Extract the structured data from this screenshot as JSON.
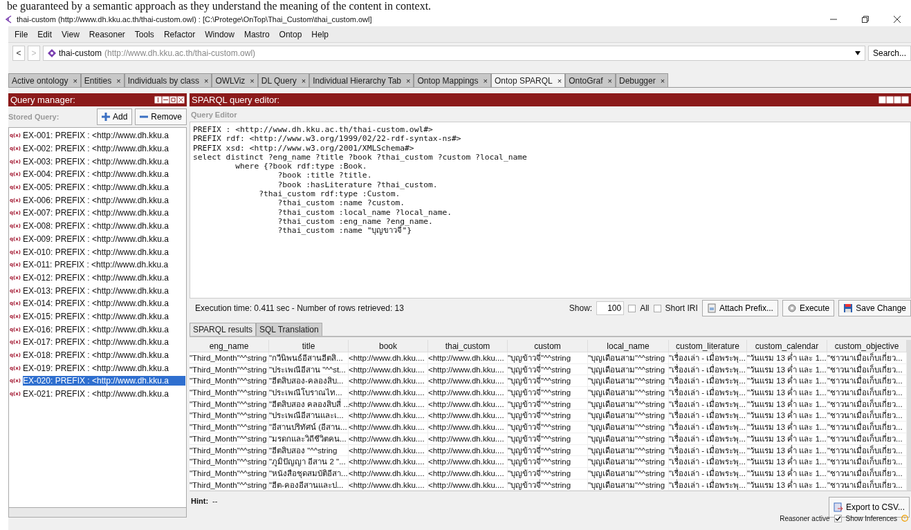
{
  "caption": "be guaranteed by a semantic approach as they understand the meaning of the content in context.",
  "window": {
    "title": "thai-custom (http://www.dh.kku.ac.th/thai-custom.owl)  : [C:\\Protege\\OnTop\\Thai_Custom\\thai_custom.owl]"
  },
  "menu": [
    "File",
    "Edit",
    "View",
    "Reasoner",
    "Tools",
    "Refactor",
    "Window",
    "Mastro",
    "Ontop",
    "Help"
  ],
  "address": {
    "back": "<",
    "forward": ">",
    "name": "thai-custom",
    "iri": "(http://www.dh.kku.ac.th/thai-custom.owl)",
    "search": "Search..."
  },
  "tabs": [
    {
      "label": "Active ontology",
      "selected": false
    },
    {
      "label": "Entities",
      "selected": false
    },
    {
      "label": "Individuals by class",
      "selected": false
    },
    {
      "label": "OWLViz",
      "selected": false
    },
    {
      "label": "DL Query",
      "selected": false
    },
    {
      "label": "Individual Hierarchy Tab",
      "selected": false
    },
    {
      "label": "Ontop Mappings",
      "selected": false
    },
    {
      "label": "Ontop SPARQL",
      "selected": true
    },
    {
      "label": "OntoGraf",
      "selected": false
    },
    {
      "label": "Debugger",
      "selected": false
    }
  ],
  "tab_close": "×",
  "query_manager": {
    "title": "Query manager:",
    "stored_label": "Stored Query:",
    "add": "Add",
    "remove": "Remove",
    "items": [
      {
        "marker": "q(x)",
        "label": "EX-001: PREFIX : <http://www.dh.kku.a",
        "selected": false
      },
      {
        "marker": "q(x)",
        "label": "EX-002: PREFIX : <http://www.dh.kku.a",
        "selected": false
      },
      {
        "marker": "q(x)",
        "label": "EX-003: PREFIX : <http://www.dh.kku.a",
        "selected": false
      },
      {
        "marker": "q(x)",
        "label": "EX-004: PREFIX : <http://www.dh.kku.a",
        "selected": false
      },
      {
        "marker": "q(x)",
        "label": "EX-005: PREFIX : <http://www.dh.kku.a",
        "selected": false
      },
      {
        "marker": "q(x)",
        "label": "EX-006: PREFIX : <http://www.dh.kku.a",
        "selected": false
      },
      {
        "marker": "q(x)",
        "label": "EX-007: PREFIX : <http://www.dh.kku.a",
        "selected": false
      },
      {
        "marker": "q(x)",
        "label": "EX-008: PREFIX : <http://www.dh.kku.a",
        "selected": false
      },
      {
        "marker": "q(x)",
        "label": "EX-009: PREFIX : <http://www.dh.kku.a",
        "selected": false
      },
      {
        "marker": "q(x)",
        "label": "EX-010: PREFIX : <http://www.dh.kku.a",
        "selected": false
      },
      {
        "marker": "q(x)",
        "label": "EX-011: PREFIX : <http://www.dh.kku.a",
        "selected": false
      },
      {
        "marker": "q(x)",
        "label": "EX-012: PREFIX : <http://www.dh.kku.a",
        "selected": false
      },
      {
        "marker": "q(x)",
        "label": "EX-013: PREFIX : <http://www.dh.kku.a",
        "selected": false
      },
      {
        "marker": "q(x)",
        "label": "EX-014: PREFIX : <http://www.dh.kku.a",
        "selected": false
      },
      {
        "marker": "q(x)",
        "label": "EX-015: PREFIX : <http://www.dh.kku.a",
        "selected": false
      },
      {
        "marker": "q(x)",
        "label": "EX-016: PREFIX : <http://www.dh.kku.a",
        "selected": false
      },
      {
        "marker": "q(x)",
        "label": "EX-017: PREFIX : <http://www.dh.kku.a",
        "selected": false
      },
      {
        "marker": "q(x)",
        "label": "EX-018: PREFIX : <http://www.dh.kku.a",
        "selected": false
      },
      {
        "marker": "q(x)",
        "label": "EX-019: PREFIX : <http://www.dh.kku.a",
        "selected": false
      },
      {
        "marker": "q(x)",
        "label": "EX-020: PREFIX : <http://www.dh.kku.a",
        "selected": true
      },
      {
        "marker": "q(x)",
        "label": "EX-021: PREFIX : <http://www.dh.kku.a",
        "selected": false
      }
    ]
  },
  "editor": {
    "title": "SPARQL query editor:",
    "label": "Query Editor",
    "query": "PREFIX : <http://www.dh.kku.ac.th/thai-custom.owl#>\nPREFIX rdf: <http://www.w3.org/1999/02/22-rdf-syntax-ns#>\nPREFIX xsd: <http://www.w3.org/2001/XMLSchema#>\nselect distinct ?eng_name ?title ?book ?thai_custom ?custom ?local_name\n         where {?book rdf:type :Book.\n                  ?book :title ?title.\n                  ?book :hasLiterature ?thai_custom.\n              ?thai_custom rdf:type :Custom.\n                  ?thai_custom :name ?custom.\n                  ?thai_custom :local_name ?local_name.\n                  ?thai_custom :eng_name ?eng_name.\n                  ?thai_custom :name \"บุญขาวจี่\"}",
    "status": "Execution time: 0.411 sec - Number of rows retrieved: 13",
    "show_label": "Show:",
    "show_value": "100",
    "all": {
      "label": "All",
      "checked": false
    },
    "short_iri": {
      "label": "Short IRI",
      "checked": false
    },
    "buttons": [
      "Attach Prefix...",
      "Execute",
      "Save Change"
    ]
  },
  "result_tabs": [
    {
      "label": "SPARQL results",
      "selected": true
    },
    {
      "label": "SQL Translation",
      "selected": false
    }
  ],
  "table": {
    "columns": [
      "eng_name",
      "title",
      "book",
      "thai_custom",
      "custom",
      "local_name",
      "custom_literature",
      "custom_calendar",
      "custom_objective"
    ],
    "rows": [
      [
        "\"Third_Month\"^^string",
        "\"กวีนิพนธ์อีสานฮีตสิ...",
        "<http://www.dh.kku....",
        "<http://www.dh.kku....",
        "\"บุญข้าวจี่\"^^string",
        "\"บุญเดือนสาม\"^^string",
        "\"เรื่องเล่า - เมื่อพระพุ...",
        "\"วันแรม 13 ค่ำ และ 1...",
        "\"ชาวนาเมื่อเก็บเกี่ยว..."
      ],
      [
        "\"Third_Month\"^^string",
        "\"ประเพณีอีสาน \"^^st...",
        "<http://www.dh.kku....",
        "<http://www.dh.kku....",
        "\"บุญข้าวจี่\"^^string",
        "\"บุญเดือนสาม\"^^string",
        "\"เรื่องเล่า - เมื่อพระพุ...",
        "\"วันแรม 13 ค่ำ และ 1...",
        "\"ชาวนาเมื่อเก็บเกี่ยว..."
      ],
      [
        "\"Third_Month\"^^string",
        "\"ฮีตสิบสอง-คลองสิบ...",
        "<http://www.dh.kku....",
        "<http://www.dh.kku....",
        "\"บุญข้าวจี่\"^^string",
        "\"บุญเดือนสาม\"^^string",
        "\"เรื่องเล่า - เมื่อพระพุ...",
        "\"วันแรม 13 ค่ำ และ 1...",
        "\"ชาวนาเมื่อเก็บเกี่ยว..."
      ],
      [
        "\"Third_Month\"^^string",
        "\"ประเพณีโบราณไท...",
        "<http://www.dh.kku....",
        "<http://www.dh.kku....",
        "\"บุญข้าวจี่\"^^string",
        "\"บุญเดือนสาม\"^^string",
        "\"เรื่องเล่า - เมื่อพระพุ...",
        "\"วันแรม 13 ค่ำ และ 1...",
        "\"ชาวนาเมื่อเก็บเกี่ยว..."
      ],
      [
        "\"Third_Month\"^^string",
        "\"ฮีตสิบสอง คลองสิบสี่ ...",
        "<http://www.dh.kku....",
        "<http://www.dh.kku....",
        "\"บุญข้าวจี่\"^^string",
        "\"บุญเดือนสาม\"^^string",
        "\"เรื่องเล่า - เมื่อพระพุ...",
        "\"วันแรม 13 ค่ำ และ 1...",
        "\"ชาวนาเมื่อเก็บเกี่ยว..."
      ],
      [
        "\"Third_Month\"^^string",
        "\"ประเพณีอีสานและเ...",
        "<http://www.dh.kku....",
        "<http://www.dh.kku....",
        "\"บุญข้าวจี่\"^^string",
        "\"บุญเดือนสาม\"^^string",
        "\"เรื่องเล่า - เมื่อพระพุ...",
        "\"วันแรม 13 ค่ำ และ 1...",
        "\"ชาวนาเมื่อเก็บเกี่ยว..."
      ],
      [
        "\"Third_Month\"^^string",
        "\"อีสานปริทัศน์ (อีสาน...",
        "<http://www.dh.kku....",
        "<http://www.dh.kku....",
        "\"บุญข้าวจี่\"^^string",
        "\"บุญเดือนสาม\"^^string",
        "\"เรื่องเล่า - เมื่อพระพุ...",
        "\"วันแรม 13 ค่ำ และ 1...",
        "\"ชาวนาเมื่อเก็บเกี่ยว..."
      ],
      [
        "\"Third_Month\"^^string",
        "\"มรดกและวิถีชีวิตคน...",
        "<http://www.dh.kku....",
        "<http://www.dh.kku....",
        "\"บุญข้าวจี่\"^^string",
        "\"บุญเดือนสาม\"^^string",
        "\"เรื่องเล่า - เมื่อพระพุ...",
        "\"วันแรม 13 ค่ำ และ 1...",
        "\"ชาวนาเมื่อเก็บเกี่ยว..."
      ],
      [
        "\"Third_Month\"^^string",
        "\"ฮีตสิบสอง \"^^string",
        "<http://www.dh.kku....",
        "<http://www.dh.kku....",
        "\"บุญข้าวจี่\"^^string",
        "\"บุญเดือนสาม\"^^string",
        "\"เรื่องเล่า - เมื่อพระพุ...",
        "\"วันแรม 13 ค่ำ และ 1...",
        "\"ชาวนาเมื่อเก็บเกี่ยว..."
      ],
      [
        "\"Third_Month\"^^string",
        "\"ภูมิปัญญา อีสาน 2 \"...",
        "<http://www.dh.kku....",
        "<http://www.dh.kku....",
        "\"บุญข้าวจี่\"^^string",
        "\"บุญเดือนสาม\"^^string",
        "\"เรื่องเล่า - เมื่อพระพุ...",
        "\"วันแรม 13 ค่ำ และ 1...",
        "\"ชาวนาเมื่อเก็บเกี่ยว..."
      ],
      [
        "\"Third_Month\"^^string",
        "\"หนังสือชุดสมบัติอีสา...",
        "<http://www.dh.kku....",
        "<http://www.dh.kku....",
        "\"บุญข้าวจี่\"^^string",
        "\"บุญเดือนสาม\"^^string",
        "\"เรื่องเล่า - เมื่อพระพุ...",
        "\"วันแรม 13 ค่ำ และ 1...",
        "\"ชาวนาเมื่อเก็บเกี่ยว..."
      ],
      [
        "\"Third_Month\"^^string",
        "\"ฮีต-คองอีสานและป...",
        "<http://www.dh.kku....",
        "<http://www.dh.kku....",
        "\"บุญข้าวจี่\"^^string",
        "\"บุญเดือนสาม\"^^string",
        "\"เรื่องเล่า - เมื่อพระพุ...",
        "\"วันแรม 13 ค่ำ และ 1...",
        "\"ชาวนาเมื่อเก็บเกี่ยว..."
      ]
    ]
  },
  "hint": {
    "label": "Hint:",
    "value": "--"
  },
  "export": "Export to CSV...",
  "status_bar": {
    "reasoner": "Reasoner active",
    "show_inferences": {
      "label": "Show Inferences",
      "checked": true
    }
  }
}
